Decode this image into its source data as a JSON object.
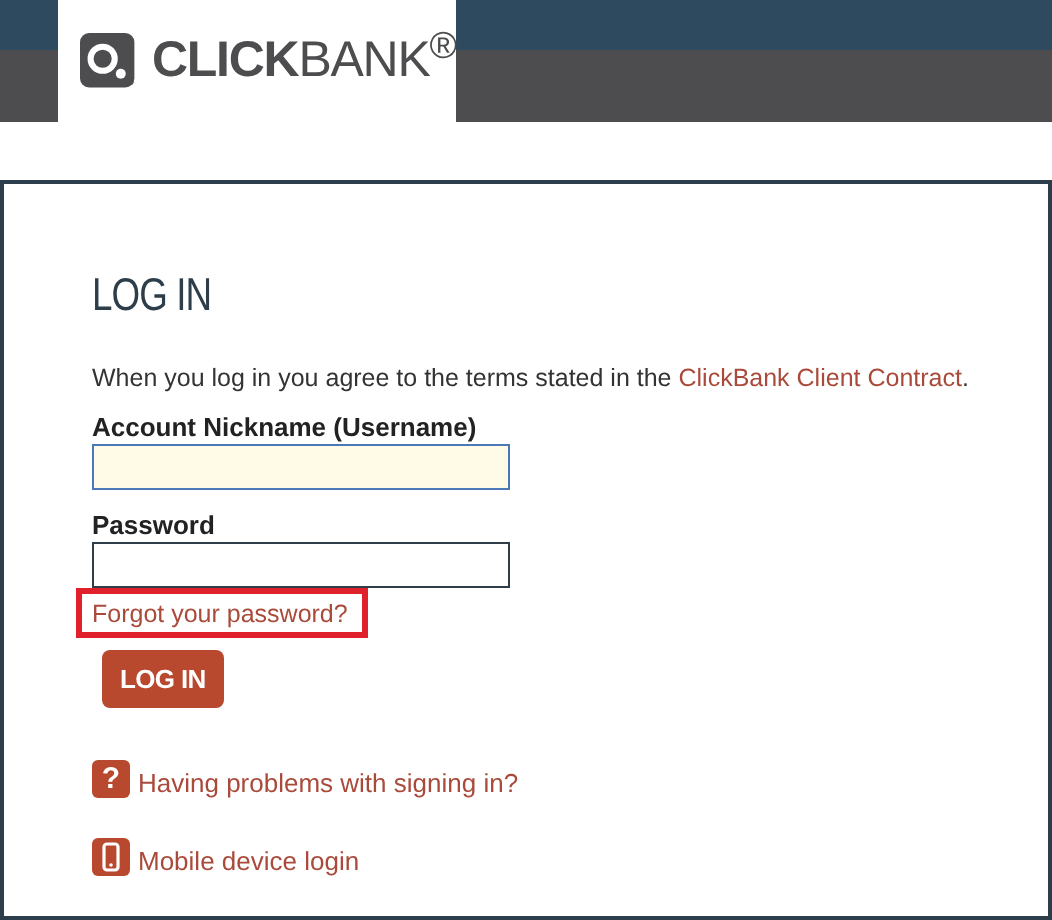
{
  "logo": {
    "text": "**CLICK**BANK$^{®}$"
  },
  "login": {
    "heading": "LOG IN",
    "terms": {
      "text": "When you log in you agree to the terms stated in the ",
      "link": "ClickBank Client Contract",
      "after": "."
    },
    "fields": [
      {
        "label": "Account Nickname (Username)",
        "autofilled": true
      },
      {
        "label": "Password",
        "autofilled": false
      }
    ],
    "forgot": {
      "text": "Forgot your password?",
      "highlighted": true
    },
    "button": "LOG IN",
    "links": [
      {
        "kind": "help",
        "icon": "?",
        "text": "Having problems with signing in?"
      },
      {
        "kind": "mobile",
        "text": "Mobile device login"
      }
    ]
  }
}
